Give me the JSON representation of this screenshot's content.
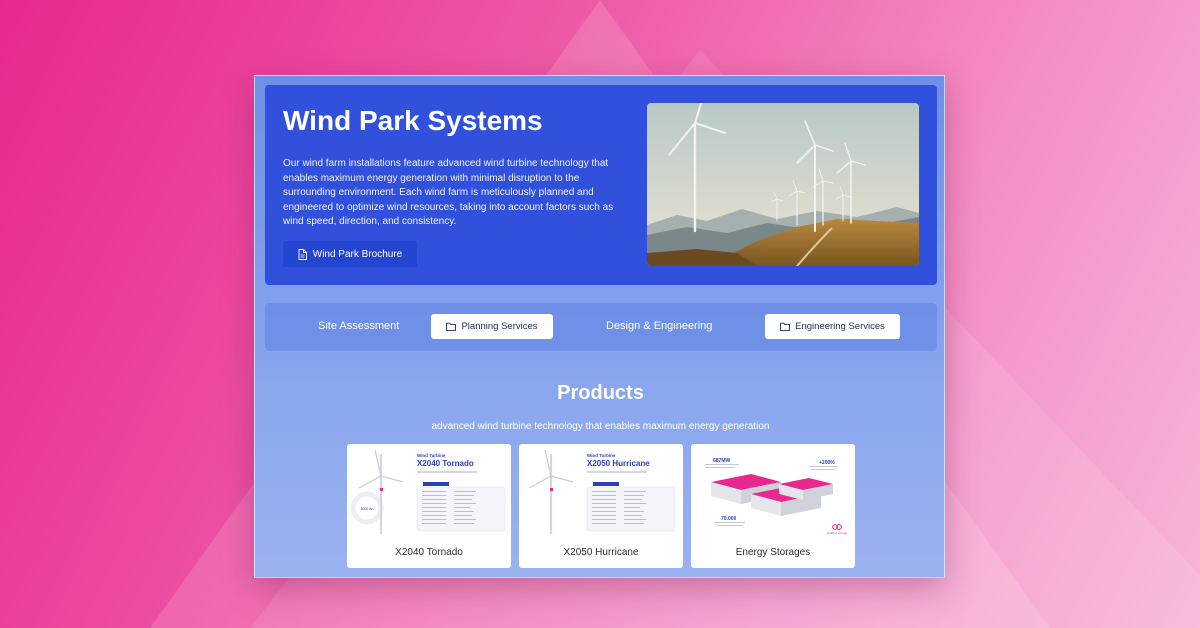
{
  "hero": {
    "title": "Wind Park Systems",
    "description": "Our wind farm installations feature advanced wind turbine technology that enables maximum energy generation with minimal disruption to the surrounding environment. Each wind farm is meticulously planned and engineered to optimize wind resources, taking into account factors such as wind speed, direction, and consistency.",
    "brochure_label": "Wind Park Brochure",
    "image_icon": "wind-turbines-photo"
  },
  "services": {
    "site_assessment_label": "Site Assessment",
    "planning_label": "Planning Services",
    "design_label": "Design & Engineering",
    "engineering_label": "Engineering Services"
  },
  "products": {
    "title": "Products",
    "subtitle": "advanced wind turbine technology that enables maximum energy generation",
    "items": [
      {
        "name": "X2040 Tornado",
        "art_small_title": "Wind Turbine",
        "art_model": "X2040 Tornado",
        "art_badge": "6000 Ah"
      },
      {
        "name": "X2050 Hurricane",
        "art_small_title": "Wind Turbine",
        "art_model": "X2050 Hurricane"
      },
      {
        "name": "Energy Storages",
        "art_stat_1": "687MW",
        "art_stat_2": "+200%",
        "art_stat_3": "70.000",
        "art_brand": "Amblox energy"
      }
    ]
  },
  "colors": {
    "hero_bg": "#3150dc",
    "button_bg": "#2445cf",
    "accent_pink": "#e8288f",
    "model_blue": "#2a3fb8"
  }
}
